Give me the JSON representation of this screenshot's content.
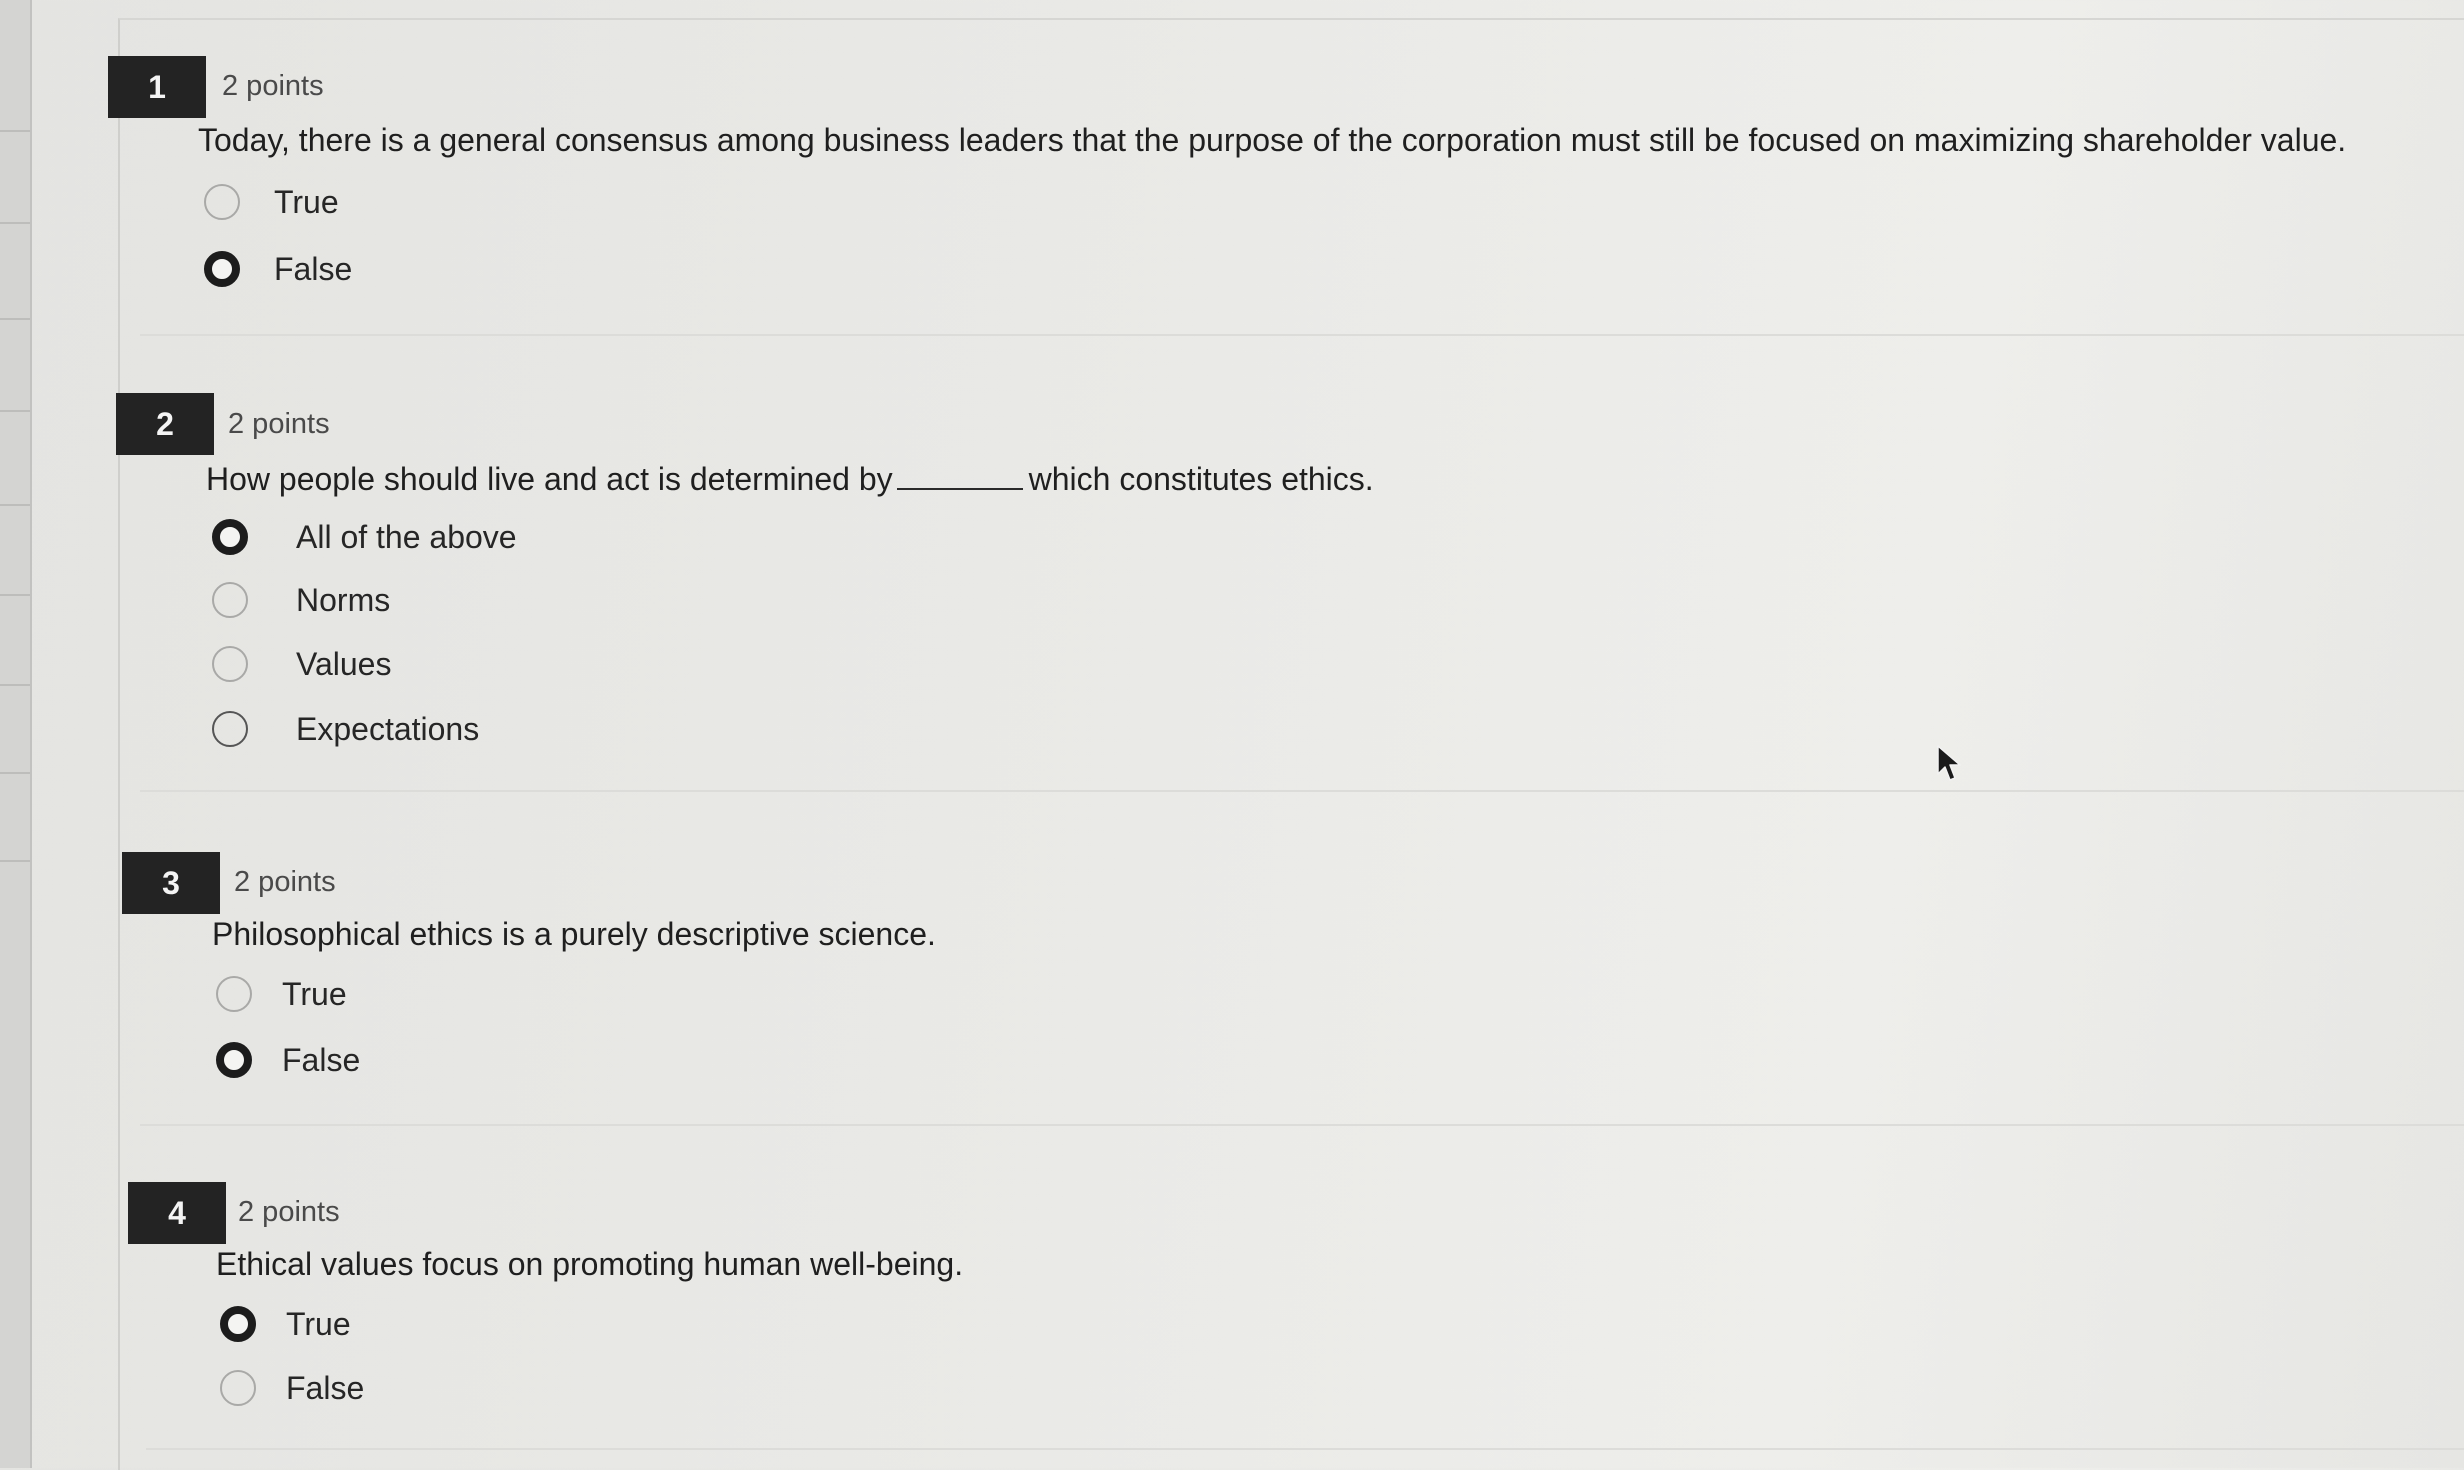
{
  "questions": [
    {
      "number": "1",
      "points": "2 points",
      "text": "Today, there is a general consensus among business leaders that the purpose of the corporation must still be focused on maximizing shareholder value.",
      "options": [
        {
          "label": "True",
          "selected": false
        },
        {
          "label": "False",
          "selected": true
        }
      ]
    },
    {
      "number": "2",
      "points": "2 points",
      "text_before": "How people should live and act is determined by",
      "text_after": "which constitutes ethics.",
      "options": [
        {
          "label": "All of the above",
          "selected": true
        },
        {
          "label": "Norms",
          "selected": false
        },
        {
          "label": "Values",
          "selected": false
        },
        {
          "label": "Expectations",
          "selected": false
        }
      ]
    },
    {
      "number": "3",
      "points": "2 points",
      "text": "Philosophical ethics is a purely descriptive science.",
      "options": [
        {
          "label": "True",
          "selected": false
        },
        {
          "label": "False",
          "selected": true
        }
      ]
    },
    {
      "number": "4",
      "points": "2 points",
      "text": "Ethical values focus on promoting human well-being.",
      "options": [
        {
          "label": "True",
          "selected": true
        },
        {
          "label": "False",
          "selected": false
        }
      ]
    }
  ],
  "icons": {
    "cursor": "mouse-pointer-icon",
    "radio_selected": "radio-selected-icon",
    "radio_unselected": "radio-unselected-icon"
  }
}
